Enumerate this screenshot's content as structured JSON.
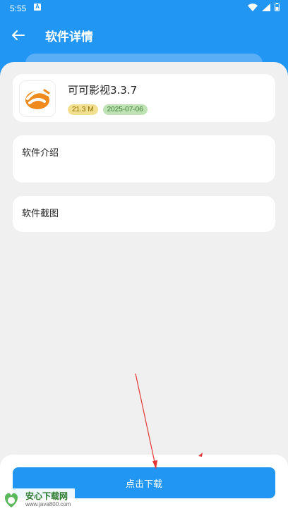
{
  "status": {
    "time": "5:55",
    "notif": "A"
  },
  "header": {
    "title": "软件详情"
  },
  "app": {
    "name": "可可影视3.3.7",
    "size": "21.3 M",
    "date": "2025-07-06"
  },
  "sections": {
    "intro_label": "软件介绍",
    "screenshots_label": "软件截图"
  },
  "action": {
    "download_label": "点击下载"
  },
  "watermark": {
    "title": "安心下载网",
    "url": "www.java800.com"
  },
  "colors": {
    "primary": "#2196f3",
    "background": "#f0f0f0",
    "logo_orange": "#f08a1c"
  }
}
